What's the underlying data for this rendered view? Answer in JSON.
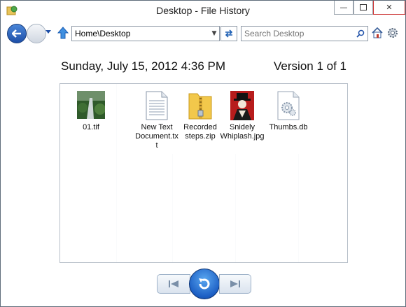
{
  "window": {
    "title": "Desktop - File History"
  },
  "toolbar": {
    "address": "Home\\Desktop",
    "search_placeholder": "Search Desktop"
  },
  "snapshot": {
    "date": "Sunday, July 15, 2012 4:36 PM",
    "version": "Version 1 of 1"
  },
  "files": [
    {
      "label": "01.tif",
      "icon": "image-file-icon"
    },
    {
      "label": "New Text Document.txt",
      "icon": "text-file-icon"
    },
    {
      "label": "Recorded steps.zip",
      "icon": "zip-folder-icon"
    },
    {
      "label": "Snidely Whiplash.jpg",
      "icon": "image-file-icon"
    },
    {
      "label": "Thumbs.db",
      "icon": "system-file-icon"
    }
  ],
  "colors": {
    "accent": "#1d4fa8",
    "close": "#cc3333"
  }
}
